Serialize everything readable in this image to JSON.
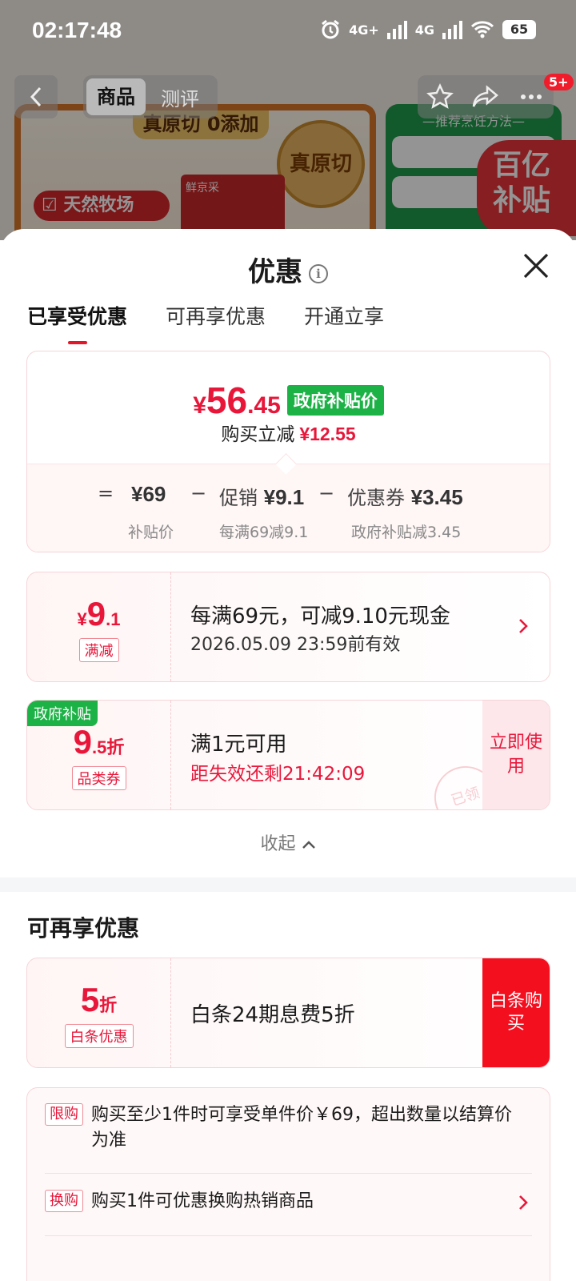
{
  "status_bar": {
    "time": "02:17:48",
    "net1": "4G+",
    "net2": "4G",
    "battery": "65"
  },
  "nav": {
    "tabs": [
      "商品",
      "测评"
    ],
    "badge": "5+"
  },
  "background": {
    "banner": "真原切 0添加",
    "seal": "真原切",
    "ranch_tag": "天然牧场",
    "bag_brand": "鲜京采",
    "right_title": "—推荐烹饪方法—",
    "subsidy_text": [
      "百亿",
      "补贴"
    ]
  },
  "sheet": {
    "title": "优惠",
    "tabs": [
      "已享受优惠",
      "可再享优惠",
      "开通立享"
    ],
    "summary": {
      "price_cur": "¥",
      "price_int": "56",
      "price_dec": ".45",
      "gov_tag": "政府补贴价",
      "instant_label": "购买立减",
      "instant_amount": "¥12.55",
      "eq": "=",
      "base_price": "¥69",
      "minus": "−",
      "promo_label": "促销",
      "promo_amount": "¥9.1",
      "coupon_label": "优惠券",
      "coupon_amount": "¥3.45",
      "sub_base": "补贴价",
      "sub_promo": "每满69减9.1",
      "sub_coupon": "政府补贴减3.45"
    },
    "coupon1": {
      "cur": "¥",
      "int": "9",
      "dec": ".1",
      "kind": "满减",
      "line1": "每满69元，可减9.10元现金",
      "line2": "2026.05.09 23:59前有效"
    },
    "coupon2": {
      "corner": "政府补贴",
      "int": "9",
      "dec": ".5折",
      "kind": "品类券",
      "line1": "满1元可用",
      "line2": "距失效还剩21:42:09",
      "action": "立即使用",
      "stamp": "已领"
    },
    "collapse": "收起",
    "more_title": "可再享优惠",
    "baitiao": {
      "int": "5",
      "dec": "折",
      "kind": "白条优惠",
      "line1": "白条24期息费5折",
      "action": "白条购买"
    },
    "rules": [
      {
        "tag": "限购",
        "text": "购买至少1件时可享受单件价￥69，超出数量以结算价为准"
      },
      {
        "tag": "换购",
        "text": "购买1件可优惠换购热销商品"
      }
    ]
  }
}
